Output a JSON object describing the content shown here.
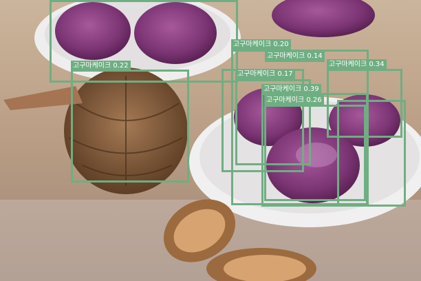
{
  "colors": {
    "box": "#6fae82",
    "label_text": "#ffffff"
  },
  "detections": [
    {
      "label": "고구마케이크 0.20"
    },
    {
      "label": "고구마케이크 0.14"
    },
    {
      "label": "고구마케이크 0.34"
    },
    {
      "label": "고구마케이크 0.22"
    },
    {
      "label": "고구마케이크 0.17"
    },
    {
      "label": "고구마케이크 0.39"
    },
    {
      "label": "고구마케이크 0.26"
    }
  ]
}
